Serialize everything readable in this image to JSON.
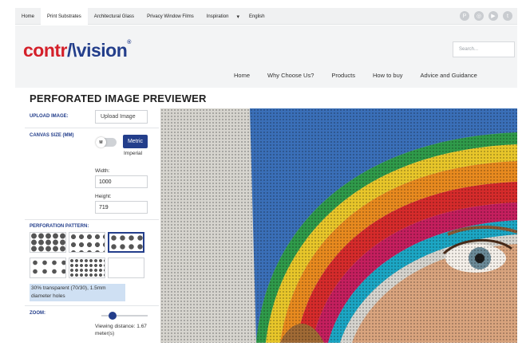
{
  "topbar": {
    "nav": [
      "Home",
      "Print Substrates",
      "Architectural Glass",
      "Privacy Window Films",
      "Inspiration"
    ],
    "active_index": 1,
    "language": "English",
    "social_icons": [
      "pinterest-icon",
      "instagram-icon",
      "youtube-icon",
      "twitter-icon"
    ]
  },
  "header": {
    "logo_left": "contr",
    "logo_mid": "/\\",
    "logo_right": "vision",
    "logo_reg": "®",
    "search_placeholder": "Search..."
  },
  "mainnav": [
    "Home",
    "Why Choose Us?",
    "Products",
    "How to buy",
    "Advice and Guidance"
  ],
  "page": {
    "title": "PERFORATED IMAGE PREVIEWER"
  },
  "panel": {
    "upload_label": "UPLOAD IMAGE:",
    "upload_button": "Upload Image",
    "canvas_label": "CANVAS SIZE (MM)",
    "toggle_knob": "M",
    "metric": "Metric",
    "imperial": "Imperial",
    "width_label": "Width:",
    "width_value": "1000",
    "height_label": "Height:",
    "height_value": "719",
    "perforation_label": "PERFORATION PATTERN:",
    "pattern_description": "30% transparent (70/30), 1.5mm diameter holes",
    "zoom_label": "ZOOM:",
    "zoom_level": 0.15,
    "viewing_distance": "Viewing distance: 1.67 meter(s)"
  },
  "colors": {
    "brand_red": "#d4202a",
    "brand_blue": "#233e8b"
  }
}
